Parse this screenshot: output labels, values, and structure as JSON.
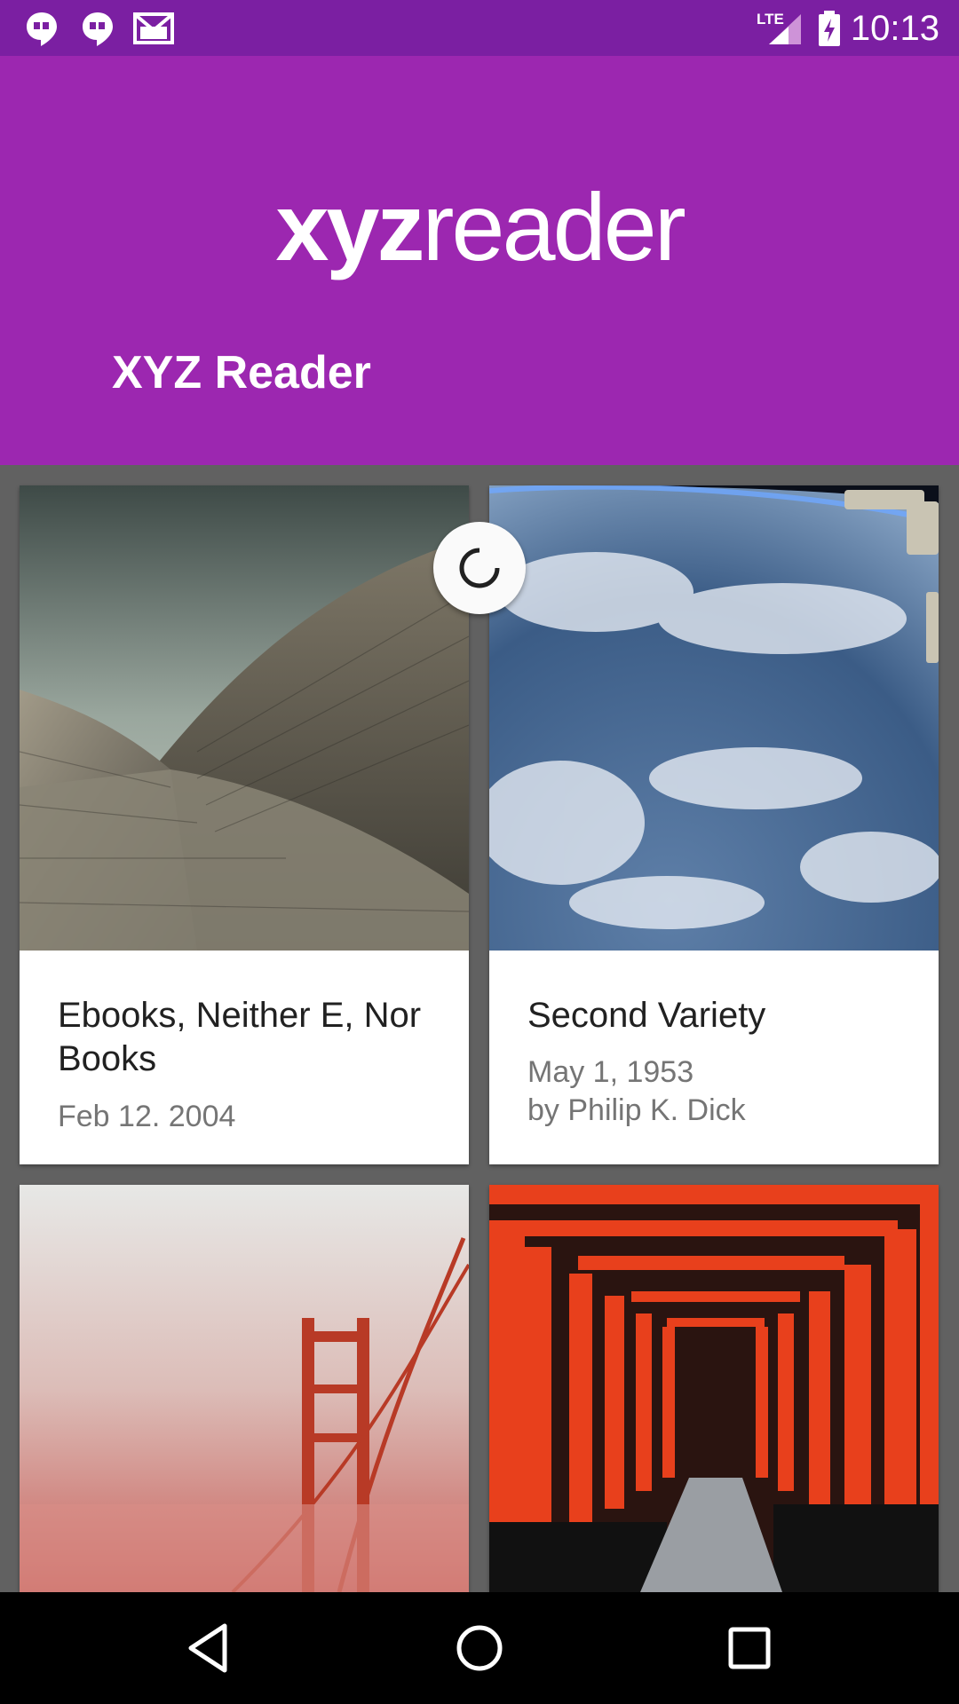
{
  "status_bar": {
    "time": "10:13",
    "notification_icons": [
      "hangouts-icon",
      "hangouts-icon",
      "gmail-icon"
    ],
    "network_label": "LTE",
    "system_icons": [
      "signal-icon",
      "battery-charging-icon"
    ]
  },
  "app_bar": {
    "logo_bold": "xyz",
    "logo_light": "reader",
    "title": "XYZ Reader",
    "color": "#9C27B0",
    "status_color": "#7B1FA2"
  },
  "articles": [
    {
      "title": "Ebooks, Neither E, Nor Books",
      "date": "Feb 12. 2004",
      "author": "",
      "image": "opera-house-roof-photo"
    },
    {
      "title": "Second Variety",
      "date": "May 1, 1953",
      "author": "by Philip K. Dick",
      "image": "earth-from-orbit-photo"
    },
    {
      "title": "",
      "date": "",
      "author": "",
      "image": "golden-gate-bridge-fog-photo"
    },
    {
      "title": "",
      "date": "",
      "author": "",
      "image": "torii-gates-path-photo"
    }
  ],
  "loading": true,
  "nav_bar": {
    "buttons": [
      "back-icon",
      "home-icon",
      "recents-icon"
    ]
  }
}
